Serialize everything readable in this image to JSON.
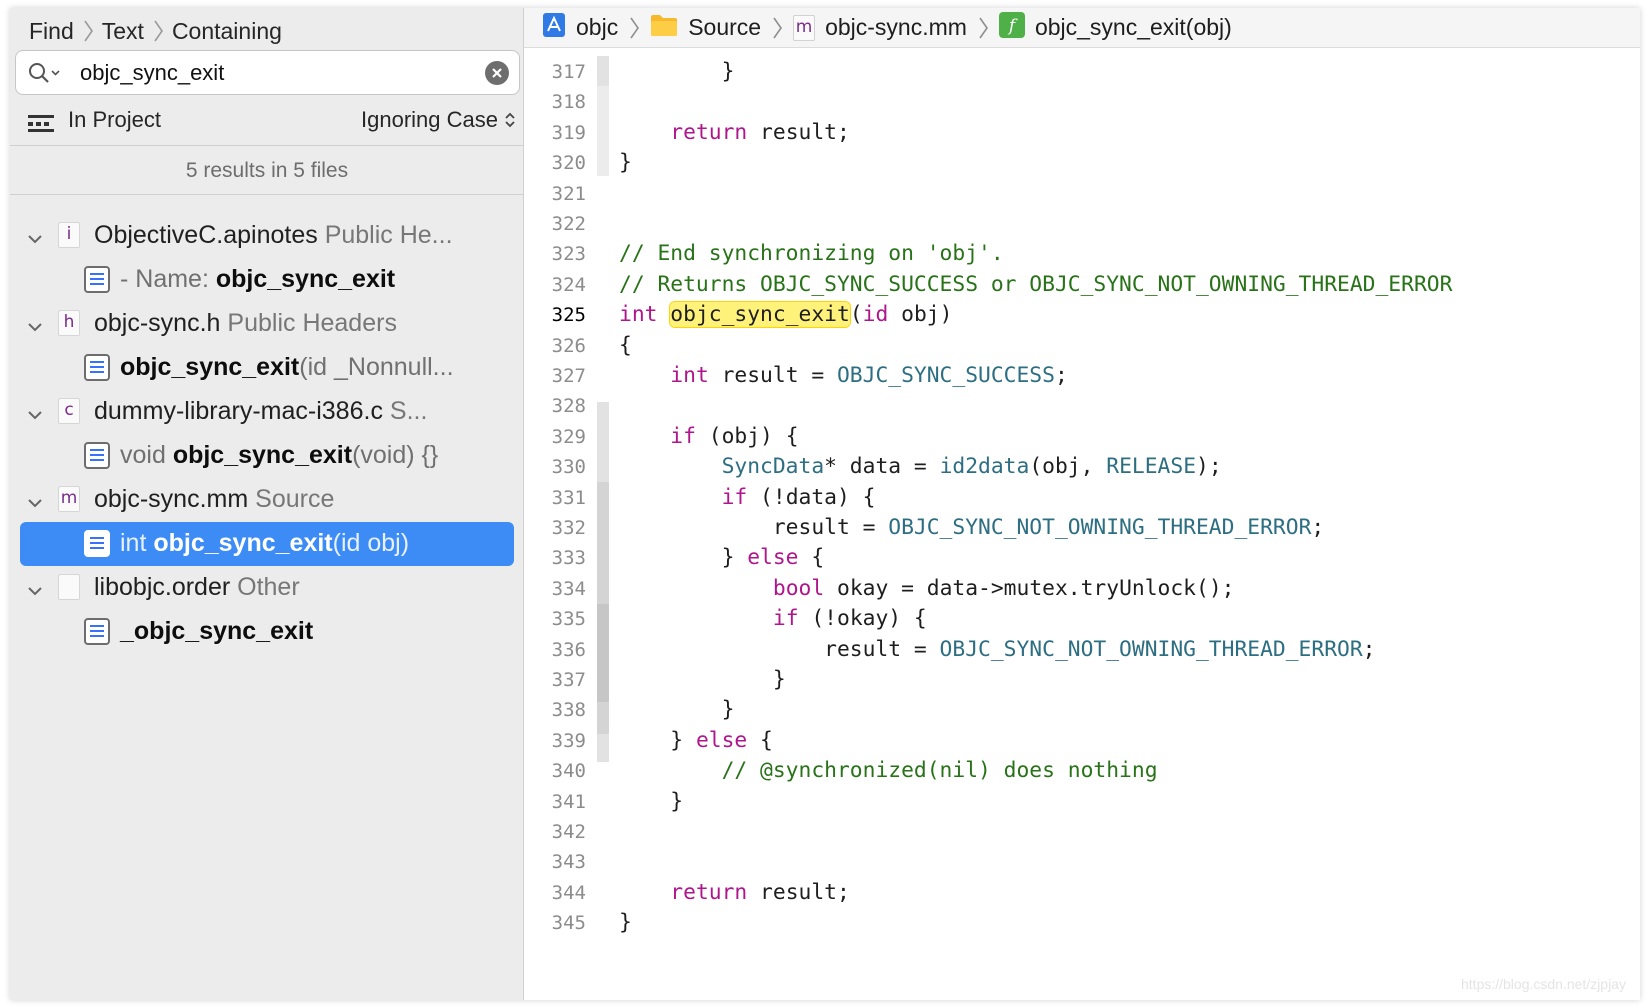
{
  "sidebar": {
    "breadcrumb": [
      "Find",
      "Text",
      "Containing"
    ],
    "search": {
      "value": "objc_sync_exit"
    },
    "scope": "In Project",
    "case": "Ignoring Case",
    "summary": "5 results in 5 files",
    "results": [
      {
        "type": "file",
        "icon_letter": "i",
        "name": "ObjectiveC.apinotes",
        "group": "Public He..."
      },
      {
        "type": "match",
        "pre": "- Name: ",
        "bold": "objc_sync_exit",
        "post": ""
      },
      {
        "type": "file",
        "icon_letter": "h",
        "name": "objc-sync.h",
        "group": "Public Headers"
      },
      {
        "type": "match",
        "pre": "",
        "bold": "objc_sync_exit",
        "post": "(id _Nonnull..."
      },
      {
        "type": "file",
        "icon_letter": "c",
        "name": "dummy-library-mac-i386.c",
        "group": "S..."
      },
      {
        "type": "match",
        "pre": "void ",
        "bold": "objc_sync_exit",
        "post": "(void) {}"
      },
      {
        "type": "file",
        "icon_letter": "m",
        "name": "objc-sync.mm",
        "group": "Source"
      },
      {
        "type": "match",
        "pre": "int ",
        "bold": "objc_sync_exit",
        "post": "(id obj)",
        "selected": true
      },
      {
        "type": "file",
        "icon_letter": "",
        "name": "libobjc.order",
        "group": "Other"
      },
      {
        "type": "match",
        "pre": "",
        "bold": "_objc_sync_exit",
        "post": ""
      }
    ]
  },
  "jumpbar": {
    "project": "objc",
    "folder": "Source",
    "file_icon_letter": "m",
    "file": "objc-sync.mm",
    "function": "objc_sync_exit(obj)"
  },
  "editor": {
    "current_line": 325,
    "lines": [
      {
        "n": 317,
        "tokens": [
          [
            "        }",
            ""
          ]
        ]
      },
      {
        "n": 318,
        "tokens": []
      },
      {
        "n": 319,
        "tokens": [
          [
            "    ",
            ""
          ],
          [
            "return",
            "kw"
          ],
          [
            " result;",
            ""
          ]
        ]
      },
      {
        "n": 320,
        "tokens": [
          [
            "}",
            ""
          ]
        ]
      },
      {
        "n": 321,
        "tokens": []
      },
      {
        "n": 322,
        "tokens": []
      },
      {
        "n": 323,
        "tokens": [
          [
            "// End synchronizing on 'obj'.",
            "cm"
          ]
        ]
      },
      {
        "n": 324,
        "tokens": [
          [
            "// Returns OBJC_SYNC_SUCCESS or OBJC_SYNC_NOT_OWNING_THREAD_ERROR",
            "cm"
          ]
        ]
      },
      {
        "n": 325,
        "tokens": [
          [
            "int",
            "kw"
          ],
          [
            " ",
            ""
          ],
          [
            "objc_sync_exit",
            "hl"
          ],
          [
            "(",
            ""
          ],
          [
            "id",
            "kw"
          ],
          [
            " obj)",
            ""
          ]
        ]
      },
      {
        "n": 326,
        "tokens": [
          [
            "{",
            ""
          ]
        ]
      },
      {
        "n": 327,
        "tokens": [
          [
            "    ",
            ""
          ],
          [
            "int",
            "kw"
          ],
          [
            " result = ",
            ""
          ],
          [
            "OBJC_SYNC_SUCCESS",
            "ty"
          ],
          [
            ";",
            ""
          ]
        ]
      },
      {
        "n": 328,
        "tokens": []
      },
      {
        "n": 329,
        "tokens": [
          [
            "    ",
            ""
          ],
          [
            "if",
            "kw"
          ],
          [
            " (obj) {",
            ""
          ]
        ]
      },
      {
        "n": 330,
        "tokens": [
          [
            "        ",
            ""
          ],
          [
            "SyncData",
            "ty"
          ],
          [
            "* data = ",
            ""
          ],
          [
            "id2data",
            "fn"
          ],
          [
            "(obj, ",
            ""
          ],
          [
            "RELEASE",
            "ty"
          ],
          [
            ");",
            ""
          ]
        ]
      },
      {
        "n": 331,
        "tokens": [
          [
            "        ",
            ""
          ],
          [
            "if",
            "kw"
          ],
          [
            " (!data) {",
            ""
          ]
        ]
      },
      {
        "n": 332,
        "tokens": [
          [
            "            result = ",
            ""
          ],
          [
            "OBJC_SYNC_NOT_OWNING_THREAD_ERROR",
            "ty"
          ],
          [
            ";",
            ""
          ]
        ]
      },
      {
        "n": 333,
        "tokens": [
          [
            "        } ",
            ""
          ],
          [
            "else",
            "kw"
          ],
          [
            " {",
            ""
          ]
        ]
      },
      {
        "n": 334,
        "tokens": [
          [
            "            ",
            ""
          ],
          [
            "bool",
            "kw"
          ],
          [
            " okay = data->mutex.tryUnlock();",
            ""
          ]
        ]
      },
      {
        "n": 335,
        "tokens": [
          [
            "            ",
            ""
          ],
          [
            "if",
            "kw"
          ],
          [
            " (!okay) {",
            ""
          ]
        ]
      },
      {
        "n": 336,
        "tokens": [
          [
            "                result = ",
            ""
          ],
          [
            "OBJC_SYNC_NOT_OWNING_THREAD_ERROR",
            "ty"
          ],
          [
            ";",
            ""
          ]
        ]
      },
      {
        "n": 337,
        "tokens": [
          [
            "            }",
            ""
          ]
        ]
      },
      {
        "n": 338,
        "tokens": [
          [
            "        }",
            ""
          ]
        ]
      },
      {
        "n": 339,
        "tokens": [
          [
            "    } ",
            ""
          ],
          [
            "else",
            "kw"
          ],
          [
            " {",
            ""
          ]
        ]
      },
      {
        "n": 340,
        "tokens": [
          [
            "        ",
            ""
          ],
          [
            "// @synchronized(nil) does nothing",
            "cm"
          ]
        ]
      },
      {
        "n": 341,
        "tokens": [
          [
            "    }",
            ""
          ]
        ]
      },
      {
        "n": 342,
        "tokens": []
      },
      {
        "n": 343,
        "tokens": []
      },
      {
        "n": 344,
        "tokens": [
          [
            "    ",
            ""
          ],
          [
            "return",
            "kw"
          ],
          [
            " result;",
            ""
          ]
        ]
      },
      {
        "n": 345,
        "tokens": [
          [
            "}",
            ""
          ]
        ]
      }
    ]
  },
  "watermark": "https://blog.csdn.net/zjpjay",
  "colors": {
    "keyword": "#b0168c",
    "comment": "#287218",
    "type": "#2d6e82",
    "highlight": "#fff27a",
    "selection": "#3d8cf5"
  }
}
